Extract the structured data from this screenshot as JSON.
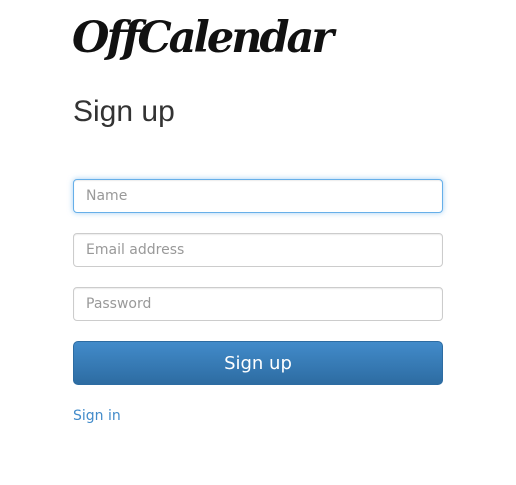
{
  "brand": {
    "logo_text": "OffCalendar"
  },
  "form": {
    "title": "Sign up",
    "name_placeholder": "Name",
    "email_placeholder": "Email address",
    "password_placeholder": "Password",
    "submit_label": "Sign up"
  },
  "links": {
    "signin_label": "Sign in"
  },
  "colors": {
    "accent": "#428bca",
    "focus_border": "#66afe9"
  }
}
